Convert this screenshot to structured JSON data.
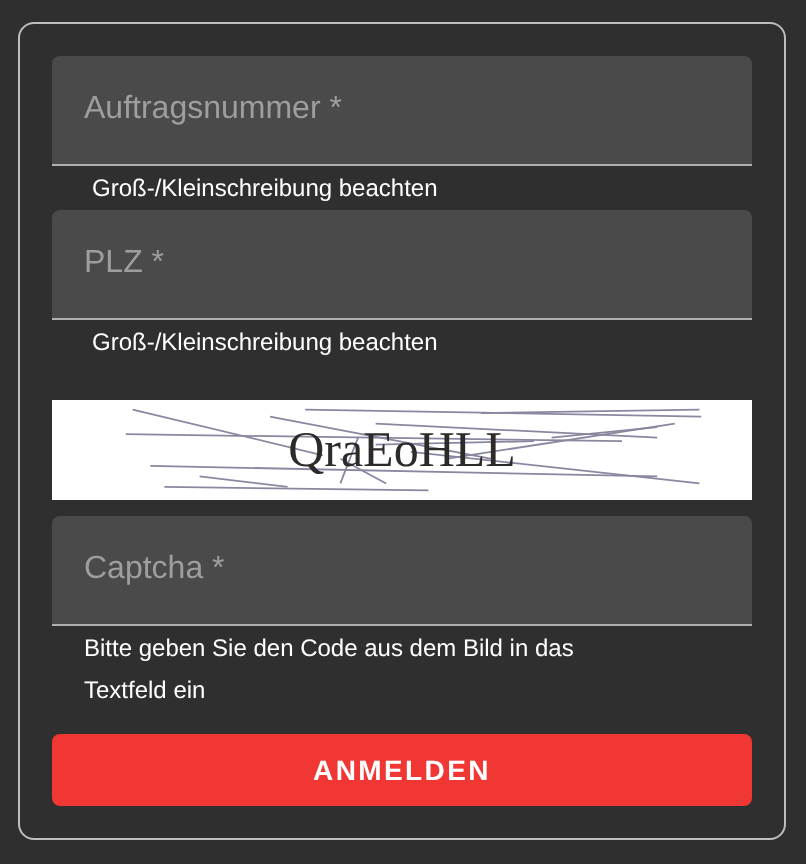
{
  "fields": [
    {
      "placeholder": "Auftragsnummer *",
      "helper": "Groß-/Kleinschreibung beachten"
    },
    {
      "placeholder": "PLZ *",
      "helper": "Groß-/Kleinschreibung beachten"
    }
  ],
  "captcha": {
    "code": "QraEoHLL"
  },
  "captcha_field": {
    "placeholder": "Captcha *",
    "helper": "Bitte geben Sie den Code aus dem Bild in das Textfeld ein"
  },
  "button": "ANMELDEN"
}
